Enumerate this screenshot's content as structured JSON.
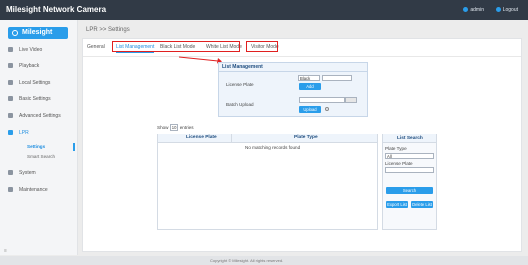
{
  "header": {
    "title": "Milesight Network Camera",
    "user": "admin",
    "logout": "Logout"
  },
  "sidebar": {
    "logo": "Milesight",
    "items": [
      {
        "label": "Live Video"
      },
      {
        "label": "Playback"
      },
      {
        "label": "Local Settings"
      },
      {
        "label": "Basic Settings"
      },
      {
        "label": "Advanced Settings"
      },
      {
        "label": "LPR"
      },
      {
        "label": "System"
      },
      {
        "label": "Maintenance"
      }
    ],
    "sub_items": [
      {
        "label": "Settings"
      },
      {
        "label": "Smart Search"
      }
    ]
  },
  "breadcrumb": "LPR >> Settings",
  "tabs": [
    {
      "label": "General"
    },
    {
      "label": "List Management"
    },
    {
      "label": "Black List Mode"
    },
    {
      "label": "White List Mode"
    },
    {
      "label": "Visitor Mode"
    }
  ],
  "list_management": {
    "title": "List Management",
    "license_plate_label": "License Plate",
    "list_type_value": "Black",
    "add_button": "Add",
    "batch_upload_label": "Batch Upload",
    "upload_button": "Upload"
  },
  "show_entries": {
    "prefix": "Show",
    "value": "10",
    "suffix": "entries"
  },
  "table": {
    "columns": [
      "License Plate",
      "Plate Type"
    ],
    "empty_message": "No matching records found"
  },
  "list_search": {
    "title": "List Search",
    "plate_type_label": "Plate Type",
    "plate_type_value": "All",
    "license_plate_label": "License Plate",
    "search_button": "Search",
    "export_button": "Export List",
    "delete_button": "Delete List"
  },
  "footer": "Copyright © Milesight. All rights reserved.",
  "colors": {
    "accent": "#2a9dea",
    "topbar": "#313a46",
    "highlight": "#e02020"
  }
}
